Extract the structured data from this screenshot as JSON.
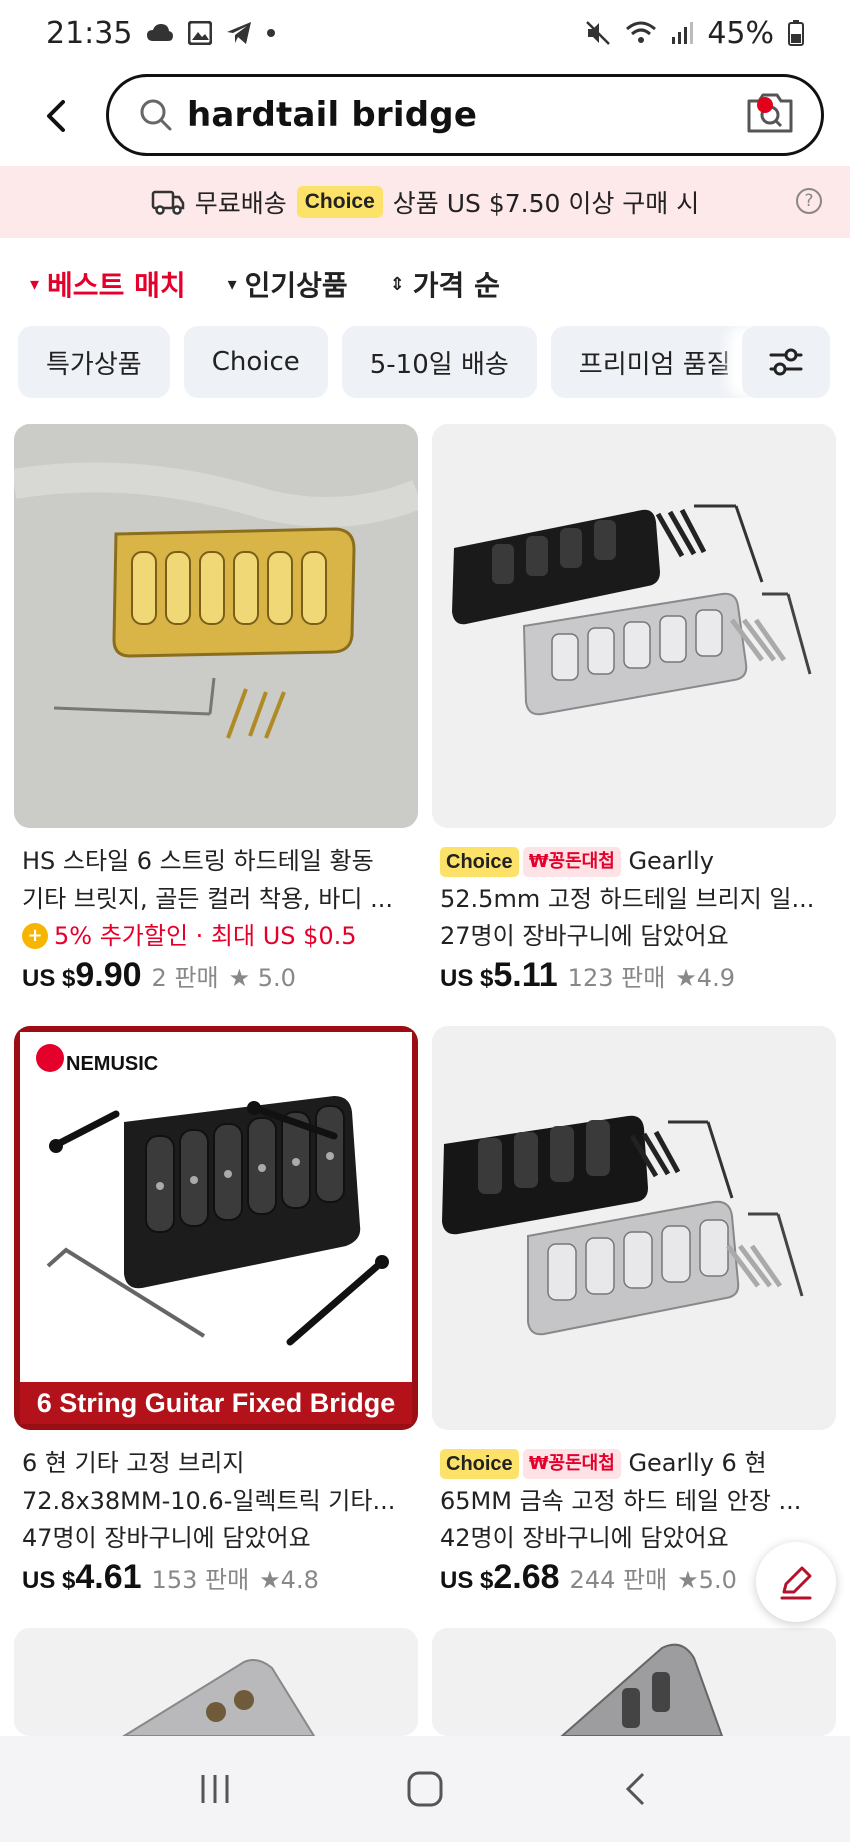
{
  "status_bar": {
    "time": "21:35",
    "battery": "45%"
  },
  "search": {
    "query": "hardtail bridge"
  },
  "promo": {
    "free_shipping": "무료배송",
    "choice": "Choice",
    "condition": "상품 US $7.50 이상 구매 시"
  },
  "sort": {
    "items": [
      {
        "label": "베스트 매치",
        "marker": "▾"
      },
      {
        "label": "인기상품",
        "marker": "▾"
      },
      {
        "label": "가격 순",
        "marker": "⇕"
      }
    ]
  },
  "chips": [
    "특가상품",
    "Choice",
    "5-10일 배송",
    "프리미엄 품질"
  ],
  "products": [
    {
      "title_line1": "HS 스타일 6 스트링 하드테일 황동",
      "title_line2": "기타 브릿지, 골든 컬러 착용, 바디 ...",
      "promo": "5% 추가할인 · 최대 US $0.5",
      "price_prefix": "US $",
      "price": "9.90",
      "sold": "2 판매",
      "rating": "5.0"
    },
    {
      "badge_choice": "Choice",
      "badge_sale": "₩꽁돈대첩",
      "title_line1": "Gearlly",
      "title_line2": "52.5mm 고정 하드테일 브리지 일...",
      "promo": "27명이 장바구니에 담았어요",
      "price_prefix": "US $",
      "price": "5.11",
      "sold": "123 판매",
      "rating": "4.9"
    },
    {
      "image_caption": "6 String Guitar Fixed Bridge",
      "brand": "NEMUSIC",
      "title_line1": "6 현 기타 고정 브리지",
      "title_line2": "72.8x38MM-10.6-일렉트릭 기타...",
      "promo": "47명이 장바구니에 담았어요",
      "price_prefix": "US $",
      "price": "4.61",
      "sold": "153 판매",
      "rating": "4.8"
    },
    {
      "badge_choice": "Choice",
      "badge_sale": "₩꽁돈대첩",
      "title_line1": "Gearlly 6 현",
      "title_line2": "65MM 금속 고정 하드 테일 안장 ...",
      "promo": "42명이 장바구니에 담았어요",
      "price_prefix": "US $",
      "price": "2.68",
      "sold": "244 판매",
      "rating": "5.0"
    }
  ],
  "colors": {
    "accent": "#e4002b",
    "choice_yellow": "#fde26a",
    "banner_pink": "#fde8ea",
    "chip_bg": "#eef1f6"
  }
}
